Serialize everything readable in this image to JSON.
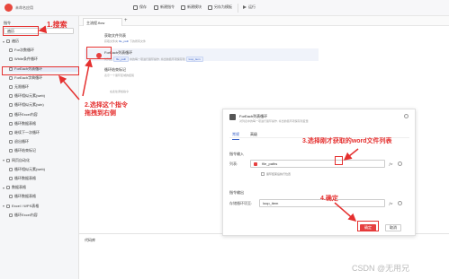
{
  "app": {
    "title": "未命名应用"
  },
  "toolbar": {
    "items": [
      {
        "label": "保存",
        "icon": "save-icon"
      },
      {
        "label": "新建指令",
        "icon": "new-command-icon"
      },
      {
        "label": "新建模块",
        "icon": "new-module-icon"
      },
      {
        "label": "另存为模板",
        "icon": "save-as-template-icon"
      },
      {
        "label": "运行",
        "icon": "run-icon"
      }
    ]
  },
  "sidebar": {
    "header": "指令",
    "search_value": "遍历",
    "items": [
      {
        "label": "遍历",
        "level": 0,
        "group": true
      },
      {
        "label": "For次数循环",
        "level": 1
      },
      {
        "label": "While条件循环",
        "level": 1
      },
      {
        "label": "ForEach列表循环",
        "level": 1,
        "selected": true
      },
      {
        "label": "ForEach字典循环",
        "level": 1
      },
      {
        "label": "无限循环",
        "level": 1
      },
      {
        "label": "循环相似元素(web)",
        "level": 1
      },
      {
        "label": "循环相似元素(win)",
        "level": 1
      },
      {
        "label": "循环Excel内容",
        "level": 1
      },
      {
        "label": "循环数据表格",
        "level": 1
      },
      {
        "label": "继续下一次循环",
        "level": 1
      },
      {
        "label": "退出循环",
        "level": 1
      },
      {
        "label": "循环结束标记",
        "level": 1
      },
      {
        "label": "网页自动化",
        "level": 0,
        "group": true
      },
      {
        "label": "循环相似元素(web)",
        "level": 1
      },
      {
        "label": "循环数据表格",
        "level": 1
      },
      {
        "label": "数据表格",
        "level": 0,
        "group": true
      },
      {
        "label": "循环数据表格",
        "level": 1
      },
      {
        "label": "Excel / WPS表格",
        "level": 0,
        "group": true
      },
      {
        "label": "循环Excel内容",
        "level": 1
      }
    ]
  },
  "editor": {
    "tab_label": "主流程.flow",
    "add_tab": "+",
    "steps": [
      {
        "title": "获取文件列表",
        "desc_parts": [
          "获取文件夹",
          "file_path",
          "下的所有文件"
        ],
        "num": "1"
      },
      {
        "title": "ForEach列表循环",
        "desc_parts": [
          "对列表",
          "file_path",
          "中的每一项进行循环操作, 将当前循环项保存到",
          "loop_item"
        ],
        "num": "2"
      },
      {
        "title": "循环结束标记",
        "desc_parts": [
          "表示一个循环区域的结尾"
        ],
        "num": "3"
      },
      {
        "title": "",
        "desc_parts": [
          "在此处添加指令"
        ],
        "num": ""
      }
    ]
  },
  "log": {
    "title": "代码库"
  },
  "dialog": {
    "title": "ForEach列表循环",
    "subtitle": "对列表中的每一项进行循环操作, 将当前循环项保存到变量",
    "tabs": [
      "常规",
      "高级"
    ],
    "section_input": "指令输入",
    "list_label": "列表:",
    "list_value": "file_paths",
    "checkbox_label": "循环结束后执行位置",
    "section_output": "指令输出",
    "output_label": "存储循环项至:",
    "output_value": "loop_item",
    "ok_label": "确定",
    "cancel_label": "取消"
  },
  "annotations": {
    "a1": "1.搜索",
    "a2_line1": "2.选择这个指令",
    "a2_line2": "拖拽到右侧",
    "a3": "3.选择刚才获取的word文件列表",
    "a4": "4.确定",
    "color": "#e5302f"
  },
  "watermark": "CSDN @无用兄"
}
